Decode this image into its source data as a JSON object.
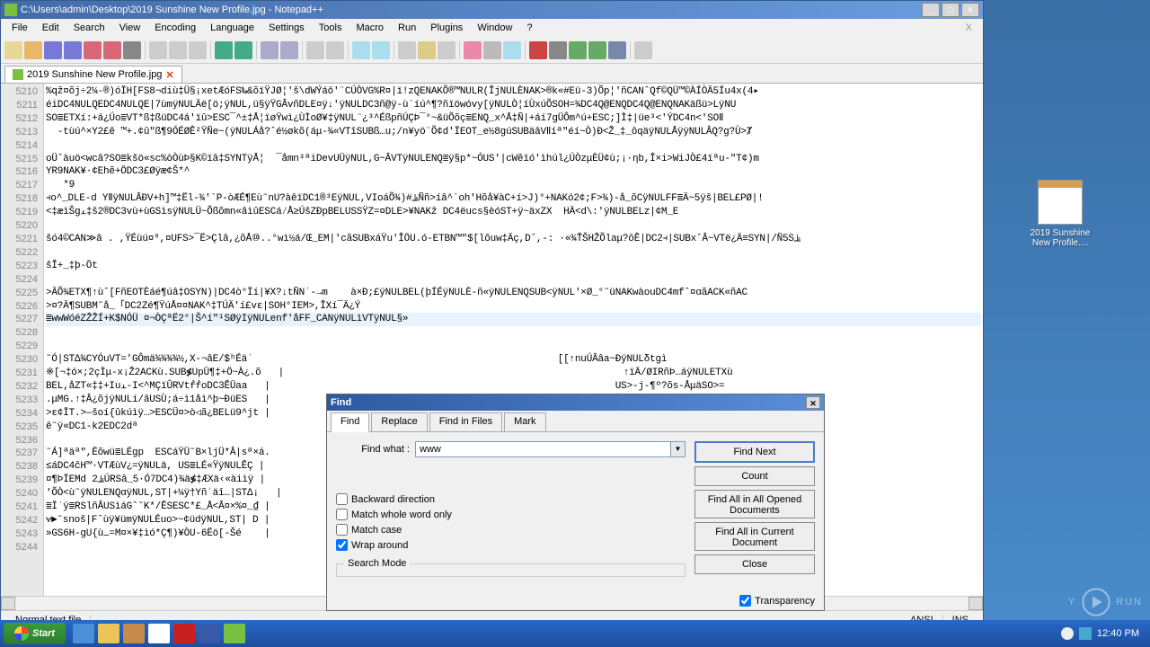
{
  "window": {
    "title": "C:\\Users\\admin\\Desktop\\2019 Sunshine New Profile.jpg - Notepad++",
    "min": "_",
    "max": "□",
    "close": "✕"
  },
  "menu": {
    "items": [
      "File",
      "Edit",
      "Search",
      "View",
      "Encoding",
      "Language",
      "Settings",
      "Tools",
      "Macro",
      "Run",
      "Plugins",
      "Window",
      "?"
    ]
  },
  "tab": {
    "label": "2019 Sunshine New Profile.jpg",
    "close": "✕"
  },
  "gutter_start": 5210,
  "gutter_count": 35,
  "lines": [
    "%qž¤õj÷2¼-®)óÏH[FS8¬diù‡Ü§¡xetÆóFS‰&õïŸJØ¦'š\\dWÝáô'¨CÚÒVG%R¤|ï!zQENAKÕ®™NULR(ÎjNULÈNAK>®k«#Eü-3)Õp¦'ñCANˆQf©QÜ™©ÀÍÒÄ5Íu4x(4▸",
    "éiDC4NULQEDC4NULQE|7ùmÿNULÄë[ö;ÿNUL,ü§ÿŸGÂvñDLE¤ÿ↓'ÿNULDC3ñ@ÿ-ù´íú^¶?ñïöwóvy[ÿNULÒ¦íÙxúÕSOH=¾DC4Q@ENQDC4Q@ENQNAKäßü>LÿNU",
    "SO≣ETXí:+á¿Úo≣VT*ß‡ßüDC4á'ïû>ESC¯^±‡Å¦ïøŸwì¿ÙÌoØ¥‡ÿNUL¨¿³^ÉßpñÚÇÞ¯°~&üÕõç≣ENQ_x^Å‡Ñ|+áí7gÜÔm^ú+ESC;]Ì‡|üe³<'ÝDC4n<'SOⅡ",
    "  -tùú^×Y2£ê ™+.¢û\"ß¶9ÓÉØÊ²ŸÑe~(ÿNULÁå?ˆé½økõ(áμ-¾«VTîSUBß…u;/n¥yö¨Õ¢d'ÏEOT_e½8gúSUBäâVⅡíª\"éí~Ò)Ð<Ž_‡_ôqäÿNULÅÿÿNULÂQ?g?Ù>Ⱦ",
    " ",
    "oÜˆàuö<wcâ?SO≣kšö«sc%òÒùÞ§K©ïâ‡SYNTÿÅ¦  ¯åmn³ªiDevUÜÿNUL,G~ÂVTÿNULENQ≣ÿ§p*~ÓUS'|cWẽïó'ìhúl¿ÚÒzμÈÜ¢ù;¡·ηb,Î×i>WiJÒ£4ïªu-\"T¢)m",
    "YR9NAK¥·¢Ehẽ+ÖDC3£Øÿæ¢Š*^",
    "   *9",
    "⫞o^_DLE-d YⅡÿNULÂÐV+h]™‡Ël-¾'`P-òÆÉ¶Eù˜nU?àêïDC1®³EÿNUL,VIoáÕ¾)#⫡Ññ>íâ^`oh'Hõå¥àC+í>J)°+NAKó2¢;F>¾)-å_õCÿNULFF≣Ä~5ÿš|BEL£PØ|!",
    "<‡æìŠg⫠‡š2®DC3vù+ùGSìsÿNULÜ~Õßõmn«âìûESCá⁄Å≥ÚšZÐpBELUSSŸZ=¤DLE>¥NAKž DC4ëucs§èóST+ÿ~äxZX  HÄ<d\\:'ÿNULBELz|¢M_E",
    " ",
    "šó4©CAN≫â . ,ŸÉùú¤⁰,¤UFS>¯Ë>Çlâ,¿õÅ⑩..°wì½á/Œ_EM|'cãSUBxáŸu'ÎÖU.ó-ETBN™\"$[lõuw‡Äç,Dˆ,-: ·«¾ŤŠHŽÕlaμ?ŏÊ|DC2⫞|SUBxˆÂ~VTë¿Ä≡SYN|/Ñ5S⫡",
    " ",
    "šÎ+_‡þ-Öt",
    " ",
    ">ÄÕ¾ETX¶↑ùˆ[FñEOTÈáé¶úâ‡OSYN)|DC4ò°Ïí|¥X?↓tÑNˈ-→m    à×Ð;£ÿNULBEL(þÍÉÿNULÈ-ñ«ÿNULENQSUB<ÿNUL'×Ø_°˜üNAKwàouDC4mfˆ¤αãACK«ñAC",
    ">¤?Ä¶SUBM˜å_「DC2Zé¶ŸúÅ¤¤NAK^‡TÚÄ'í£vε|SOH°IEM>,ÎXí¯Ä¿Ý",
    "≣wwWóéZŽŽÍ+K$NÓÜ ¤¬ÒÇªË2°|Š^í\"¹SØÿIÿNULenf'åFF_CANÿNULìVTÿNUL§»",
    " ",
    " ",
    "˜Ó|ST∆¾CYÓuVT='GÔmä¾¾¾¾½,X-¬âE/$ʰÉäˈ                                                     [[↑nuÚÂâa~ÐÿNULδtgì",
    "※[¬‡ó×;2çÌμ-x¡Ž2ACKù.SUB≸UpÜ¶‡+Ö~À¿.õ   |                                                           ↑ïÄ/ØIRñÞ…áÿNULETXù",
    "BEL,åZT«‡‡+Iu⫠-I<^MÇïÛRVtḟḟoDC3ÊÜaa   |                                                            US>-j-¶º?õs-ÅμäSO>=",
    ".μMG.↑‡Â¿õjÿNULí/âUSÙ;á÷ì1åì^þ~ÐüES   |                                                            È'Å;]¤¢7US92ù'£ío™◁×",
    ">ε¢ÏT.>—šoí{ûkúìÿ…>ESCÜ¤>ò◁ã¿BELü9^jt |                                                            .—SYN  DC2ü…šII-á‡%Yn",
    "ê˜ÿ«DC1-k2EDC2dª",
    " ",
    "˜Á]ªäª\",Ëõwü≣LÉgp  ESCáŸÜ˜B×ljÜ*Â|sª×á.                                                            ¥j-?DC4<GScù¿ÎÕô)ENQ",
    "≤áDC4ĉH™·VTÆùV¿=ÿNULä, US≣LÉ«ŸÿNULÊÇ |                                                            ETX*(US˜ⅡBELÿNUL,|EM",
    "¤¶ÞÏEMd 2⫡ÚRSâ_5·Ó7DC4)¾ä≸‡ÆXä‹«àiìÿ |                                                            :úÐjÿNULf∊¿ję͂SYN×Ž⑩.ÿ",
    "'ÕÒ<ù˜ÿNULENQαÿNUL,ST|+¼ÿ†Yñˈäî…|ST∆¡   |                                                       çˆÇ…|íáMJÇTñÍ~qq ¤«K",
    "≣Ïˈÿ≣RSlñÂUSìáGˆ˜K*/ÊSESC*£_Å<Â¤×%¤_₫ |                                                            >ë^vím-õ·®≣HÆ/õ˜¤ ö-",
    "⩝►˜snoš|Fˆùÿ¥ümÿNULÉuo>~¢üdÿNUL,ST| D |                                                            ‡Áù¢*%↑4±õô‡%-«/SOⅡ",
    "»GS6H-gU{ù⚊=M¤×¥‡ìó*Ç¶)¥ÒU-6Ëö[-Šé    |                                                            ≣Üö^À>!ÐüÚáïK|Ü§M\"^ú‡+"
  ],
  "status": {
    "left": "Normal text file",
    "enc": "ANSI",
    "ins": "INS"
  },
  "find": {
    "title": "Find",
    "close": "✕",
    "tabs": [
      "Find",
      "Replace",
      "Find in Files",
      "Mark"
    ],
    "what_label": "Find what :",
    "what_value": "www",
    "checks": {
      "backward": "Backward direction",
      "whole": "Match whole word only",
      "case": "Match case",
      "wrap": "Wrap around"
    },
    "wrap_checked": true,
    "transparency": "Transparency",
    "transparency_checked": true,
    "search_mode": "Search Mode",
    "buttons": {
      "next": "Find Next",
      "count": "Count",
      "all_open": "Find All in All Opened Documents",
      "all_current": "Find All in Current Document",
      "close": "Close"
    }
  },
  "desktop_icon": "2019 Sunshine New Profile....",
  "taskbar": {
    "start": "Start",
    "time": "12:40 PM"
  },
  "watermark": {
    "text1": "Y",
    "text2": "RUN"
  }
}
